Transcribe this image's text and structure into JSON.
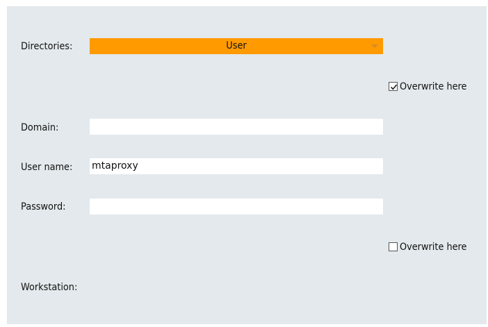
{
  "form": {
    "directories": {
      "label": "Directories:",
      "selected": "User",
      "highlight_color": "#ff9a00"
    },
    "overwrite_directories": {
      "label": "Overwrite here",
      "checked": true
    },
    "domain": {
      "label": "Domain:",
      "value": ""
    },
    "user_name": {
      "label": "User name:",
      "value": "mtaproxy"
    },
    "password": {
      "label": "Password:",
      "value": ""
    },
    "overwrite_workstation": {
      "label": "Overwrite here",
      "checked": false
    },
    "workstation": {
      "label": "Workstation:"
    }
  },
  "colors": {
    "panel_background": "#e3e9ec",
    "field_background": "#ffffff"
  }
}
